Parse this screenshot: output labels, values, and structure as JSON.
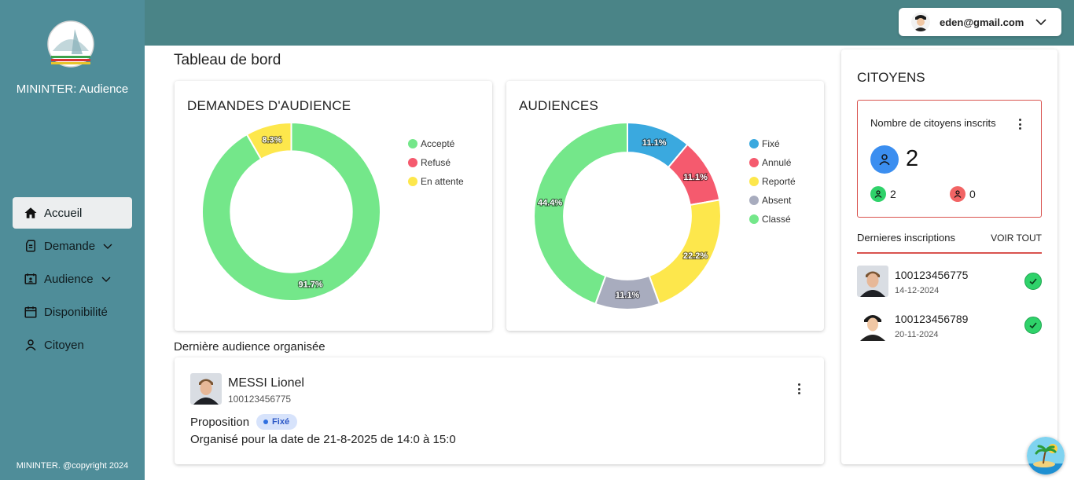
{
  "sidebar": {
    "app_name": "MININTER: Audience",
    "items": [
      {
        "label": "Accueil",
        "icon": "home-icon"
      },
      {
        "label": "Demande",
        "icon": "document-icon"
      },
      {
        "label": "Audience",
        "icon": "audience-icon"
      },
      {
        "label": "Disponibilité",
        "icon": "calendar-icon"
      },
      {
        "label": "Citoyen",
        "icon": "person-icon"
      }
    ],
    "copyright": "MININTER. @copyright 2024"
  },
  "header": {
    "user_email": "eden@gmail.com"
  },
  "page_title": "Tableau de bord",
  "chart_data": [
    {
      "type": "pie",
      "title": "DEMANDES D'AUDIENCE",
      "categories": [
        "Accepté",
        "Refusé",
        "En attente"
      ],
      "values": [
        91.7,
        0,
        8.3
      ],
      "labels": [
        "91.7%",
        "",
        "8.3%"
      ],
      "colors": [
        "#74e78a",
        "#f55a6e",
        "#fde74c"
      ]
    },
    {
      "type": "pie",
      "title": "AUDIENCES",
      "categories": [
        "Fixé",
        "Annulé",
        "Reporté",
        "Absent",
        "Classé"
      ],
      "values": [
        11.1,
        11.1,
        22.2,
        11.1,
        44.4
      ],
      "labels": [
        "11.1%",
        "11.1%",
        "22.2%",
        "11.1%",
        "44.4%"
      ],
      "colors": [
        "#3aa9df",
        "#f55a6e",
        "#fde74c",
        "#a8acbe",
        "#74e78a"
      ]
    }
  ],
  "last_audience": {
    "section_label": "Dernière audience organisée",
    "name": "MESSI Lionel",
    "id": "100123456775",
    "proposition_label": "Proposition",
    "status": "Fixé",
    "organised_text": "Organisé pour la date de 21-8-2025 de 14:0 à 15:0"
  },
  "citoyens": {
    "title": "CITOYENS",
    "stat_label": "Nombre de citoyens inscrits",
    "total": "2",
    "active": "2",
    "inactive": "0",
    "recent_title": "Dernieres inscriptions",
    "voir_tout": "VOIR TOUT",
    "recent": [
      {
        "id": "100123456775",
        "date": "14-12-2024"
      },
      {
        "id": "100123456789",
        "date": "20-11-2024"
      }
    ]
  }
}
